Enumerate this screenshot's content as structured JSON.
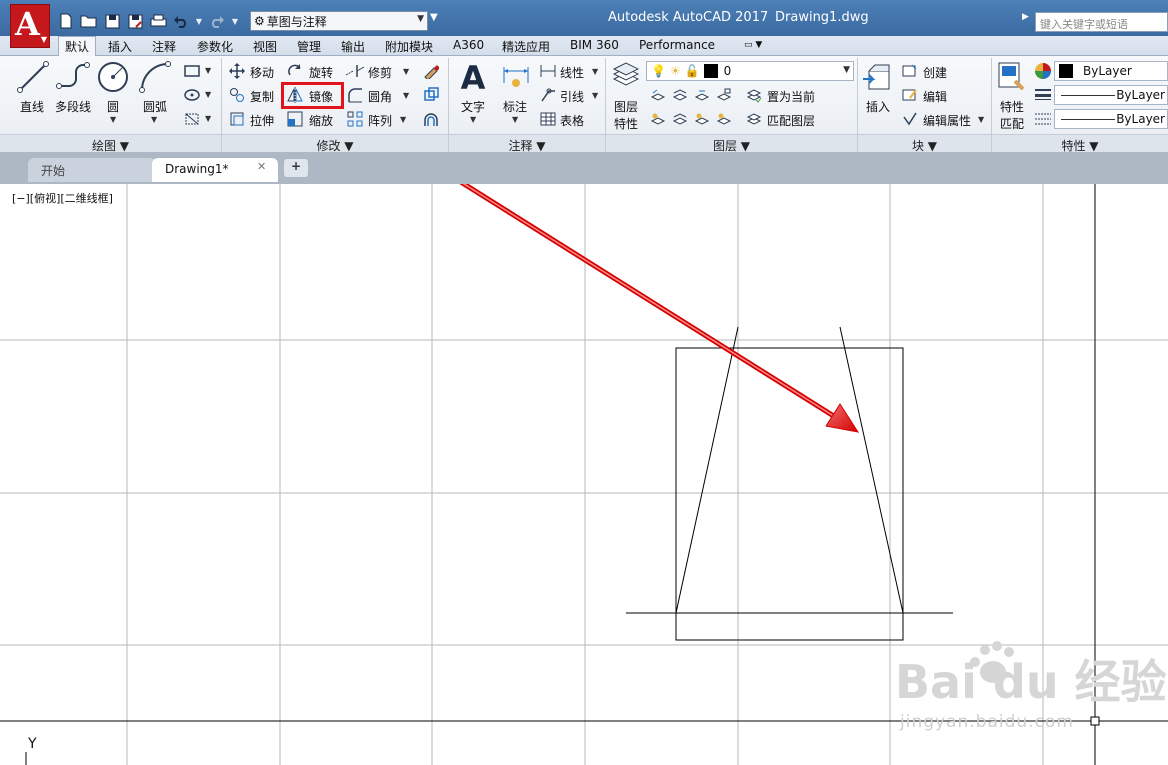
{
  "titlebar": {
    "app_title": "Autodesk AutoCAD 2017",
    "file_title": "Drawing1.dwg",
    "workspace": "草图与注释",
    "search_placeholder": "键入关键字或短语",
    "logo_letter": "A"
  },
  "ribbon_tabs": [
    "默认",
    "插入",
    "注释",
    "参数化",
    "视图",
    "管理",
    "输出",
    "附加模块",
    "A360",
    "精选应用",
    "BIM 360",
    "Performance"
  ],
  "panels": {
    "draw": {
      "title": "绘图",
      "tools": [
        "直线",
        "多段线",
        "圆",
        "圆弧"
      ]
    },
    "modify": {
      "title": "修改",
      "tools": [
        "移动",
        "旋转",
        "修剪",
        "复制",
        "镜像",
        "圆角",
        "拉伸",
        "缩放",
        "阵列"
      ]
    },
    "annotation": {
      "title": "注释",
      "tools": [
        "文字",
        "标注",
        "线性",
        "引线",
        "表格"
      ]
    },
    "layers": {
      "title": "图层",
      "tools": [
        "图层特性",
        "置为当前",
        "匹配图层"
      ],
      "layer_property_line1": "图层",
      "layer_property_line2": "特性",
      "current_layer": "0"
    },
    "block": {
      "title": "块",
      "tools": [
        "插入",
        "创建",
        "编辑",
        "编辑属性"
      ]
    },
    "properties": {
      "title": "特性",
      "match_line1": "特性",
      "match_line2": "匹配",
      "color": "ByLayer",
      "linetype": "ByLayer",
      "lineweight": "ByLayer"
    }
  },
  "file_tabs": [
    "开始",
    "Drawing1*"
  ],
  "viewport_label": "[−][俯视][二维线框]",
  "ucs_axis": "Y",
  "watermark": {
    "brand": "Bai du 经验",
    "url": "jingyan.baidu.com"
  },
  "highlight_color": "#e2141b",
  "accent_color": "#c5181c"
}
